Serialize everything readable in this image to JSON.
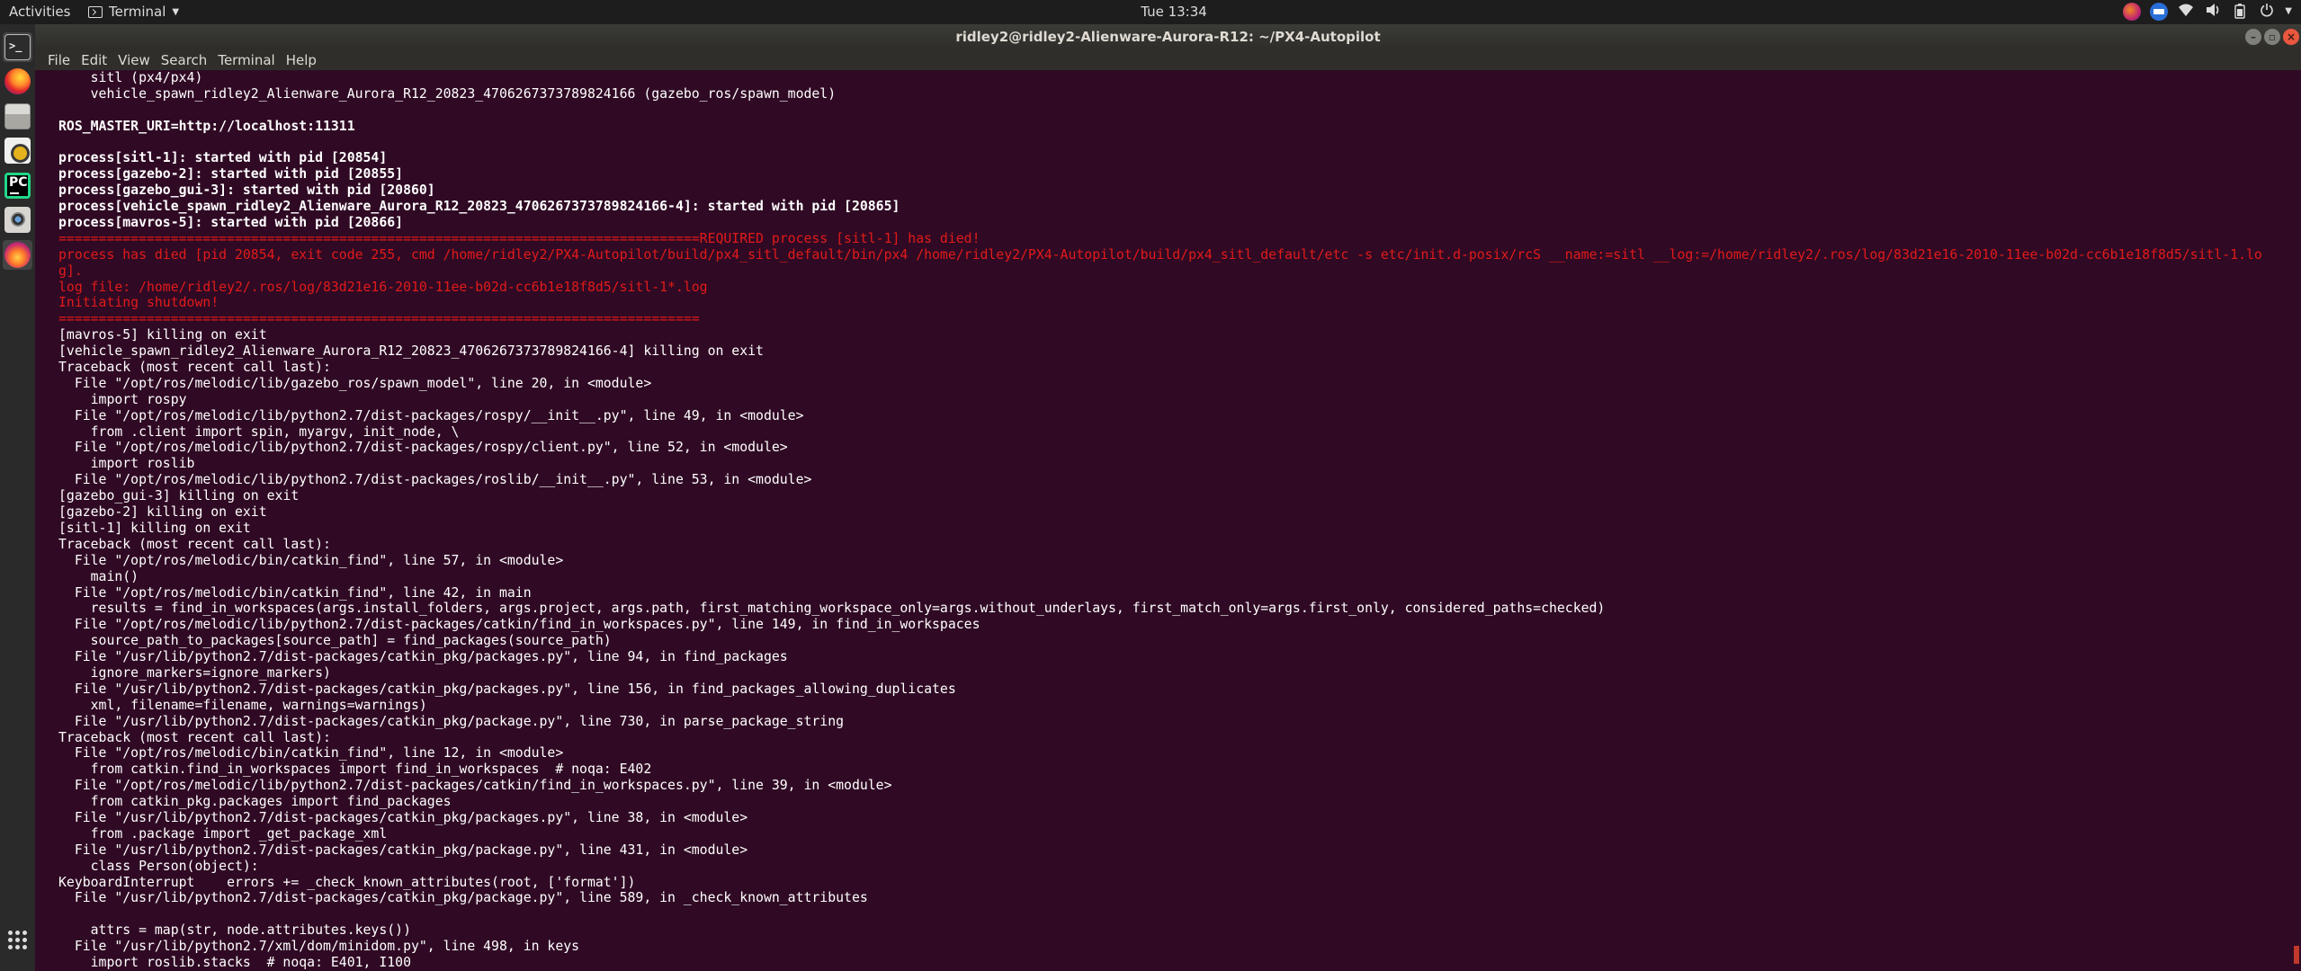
{
  "topbar": {
    "activities": "Activities",
    "app_name": "Terminal",
    "clock": "Tue 13:34",
    "tray_icons": [
      "flameshot-tray-icon",
      "mail-tray-icon",
      "wifi-icon",
      "volume-icon",
      "battery-icon",
      "power-icon",
      "chevron-down-icon"
    ]
  },
  "dock": {
    "items": [
      "terminal",
      "firefox",
      "files",
      "rhythmbox",
      "pycharm",
      "camera",
      "flameshot"
    ],
    "show_apps": "show-applications"
  },
  "window": {
    "title": "ridley2@ridley2-Alienware-Aurora-R12: ~/PX4-Autopilot",
    "menu": [
      "File",
      "Edit",
      "View",
      "Search",
      "Terminal",
      "Help"
    ]
  },
  "terminal": {
    "colors": {
      "background": "#300a24",
      "text": "#ffffff",
      "error": "#e21a1a"
    },
    "lines": [
      {
        "text": "    sitl (px4/px4)",
        "style": "normal"
      },
      {
        "text": "    vehicle_spawn_ridley2_Alienware_Aurora_R12_20823_4706267373789824166 (gazebo_ros/spawn_model)",
        "style": "normal"
      },
      {
        "text": "",
        "style": "normal"
      },
      {
        "text": "ROS_MASTER_URI=http://localhost:11311",
        "style": "bold"
      },
      {
        "text": "",
        "style": "normal"
      },
      {
        "text": "process[sitl-1]: started with pid [20854]",
        "style": "bold"
      },
      {
        "text": "process[gazebo-2]: started with pid [20855]",
        "style": "bold"
      },
      {
        "text": "process[gazebo_gui-3]: started with pid [20860]",
        "style": "bold"
      },
      {
        "text": "process[vehicle_spawn_ridley2_Alienware_Aurora_R12_20823_4706267373789824166-4]: started with pid [20865]",
        "style": "bold"
      },
      {
        "text": "process[mavros-5]: started with pid [20866]",
        "style": "bold"
      },
      {
        "text": "================================================================================REQUIRED process [sitl-1] has died!",
        "style": "red"
      },
      {
        "text": "process has died [pid 20854, exit code 255, cmd /home/ridley2/PX4-Autopilot/build/px4_sitl_default/bin/px4 /home/ridley2/PX4-Autopilot/build/px4_sitl_default/etc -s etc/init.d-posix/rcS __name:=sitl __log:=/home/ridley2/.ros/log/83d21e16-2010-11ee-b02d-cc6b1e18f8d5/sitl-1.lo",
        "style": "red"
      },
      {
        "text": "g].",
        "style": "red"
      },
      {
        "text": "log file: /home/ridley2/.ros/log/83d21e16-2010-11ee-b02d-cc6b1e18f8d5/sitl-1*.log",
        "style": "red"
      },
      {
        "text": "Initiating shutdown!",
        "style": "red"
      },
      {
        "text": "================================================================================",
        "style": "red"
      },
      {
        "text": "[mavros-5] killing on exit",
        "style": "normal"
      },
      {
        "text": "[vehicle_spawn_ridley2_Alienware_Aurora_R12_20823_4706267373789824166-4] killing on exit",
        "style": "normal"
      },
      {
        "text": "Traceback (most recent call last):",
        "style": "normal"
      },
      {
        "text": "  File \"/opt/ros/melodic/lib/gazebo_ros/spawn_model\", line 20, in <module>",
        "style": "normal"
      },
      {
        "text": "    import rospy",
        "style": "normal"
      },
      {
        "text": "  File \"/opt/ros/melodic/lib/python2.7/dist-packages/rospy/__init__.py\", line 49, in <module>",
        "style": "normal"
      },
      {
        "text": "    from .client import spin, myargv, init_node, \\",
        "style": "normal"
      },
      {
        "text": "  File \"/opt/ros/melodic/lib/python2.7/dist-packages/rospy/client.py\", line 52, in <module>",
        "style": "normal"
      },
      {
        "text": "    import roslib",
        "style": "normal"
      },
      {
        "text": "  File \"/opt/ros/melodic/lib/python2.7/dist-packages/roslib/__init__.py\", line 53, in <module>",
        "style": "normal"
      },
      {
        "text": "[gazebo_gui-3] killing on exit",
        "style": "normal"
      },
      {
        "text": "[gazebo-2] killing on exit",
        "style": "normal"
      },
      {
        "text": "[sitl-1] killing on exit",
        "style": "normal"
      },
      {
        "text": "Traceback (most recent call last):",
        "style": "normal"
      },
      {
        "text": "  File \"/opt/ros/melodic/bin/catkin_find\", line 57, in <module>",
        "style": "normal"
      },
      {
        "text": "    main()",
        "style": "normal"
      },
      {
        "text": "  File \"/opt/ros/melodic/bin/catkin_find\", line 42, in main",
        "style": "normal"
      },
      {
        "text": "    results = find_in_workspaces(args.install_folders, args.project, args.path, first_matching_workspace_only=args.without_underlays, first_match_only=args.first_only, considered_paths=checked)",
        "style": "normal"
      },
      {
        "text": "  File \"/opt/ros/melodic/lib/python2.7/dist-packages/catkin/find_in_workspaces.py\", line 149, in find_in_workspaces",
        "style": "normal"
      },
      {
        "text": "    source_path_to_packages[source_path] = find_packages(source_path)",
        "style": "normal"
      },
      {
        "text": "  File \"/usr/lib/python2.7/dist-packages/catkin_pkg/packages.py\", line 94, in find_packages",
        "style": "normal"
      },
      {
        "text": "    ignore_markers=ignore_markers)",
        "style": "normal"
      },
      {
        "text": "  File \"/usr/lib/python2.7/dist-packages/catkin_pkg/packages.py\", line 156, in find_packages_allowing_duplicates",
        "style": "normal"
      },
      {
        "text": "    xml, filename=filename, warnings=warnings)",
        "style": "normal"
      },
      {
        "text": "  File \"/usr/lib/python2.7/dist-packages/catkin_pkg/package.py\", line 730, in parse_package_string",
        "style": "normal"
      },
      {
        "text": "Traceback (most recent call last):",
        "style": "normal"
      },
      {
        "text": "  File \"/opt/ros/melodic/bin/catkin_find\", line 12, in <module>",
        "style": "normal"
      },
      {
        "text": "    from catkin.find_in_workspaces import find_in_workspaces  # noqa: E402",
        "style": "normal"
      },
      {
        "text": "  File \"/opt/ros/melodic/lib/python2.7/dist-packages/catkin/find_in_workspaces.py\", line 39, in <module>",
        "style": "normal"
      },
      {
        "text": "    from catkin_pkg.packages import find_packages",
        "style": "normal"
      },
      {
        "text": "  File \"/usr/lib/python2.7/dist-packages/catkin_pkg/packages.py\", line 38, in <module>",
        "style": "normal"
      },
      {
        "text": "    from .package import _get_package_xml",
        "style": "normal"
      },
      {
        "text": "  File \"/usr/lib/python2.7/dist-packages/catkin_pkg/package.py\", line 431, in <module>",
        "style": "normal"
      },
      {
        "text": "    class Person(object):",
        "style": "normal"
      },
      {
        "text": "KeyboardInterrupt    errors += _check_known_attributes(root, ['format'])",
        "style": "normal"
      },
      {
        "text": "  File \"/usr/lib/python2.7/dist-packages/catkin_pkg/package.py\", line 589, in _check_known_attributes",
        "style": "normal"
      },
      {
        "text": "",
        "style": "normal"
      },
      {
        "text": "    attrs = map(str, node.attributes.keys())",
        "style": "normal"
      },
      {
        "text": "  File \"/usr/lib/python2.7/xml/dom/minidom.py\", line 498, in keys",
        "style": "normal"
      },
      {
        "text": "    import roslib.stacks  # noqa: E401, I100",
        "style": "normal"
      }
    ]
  }
}
